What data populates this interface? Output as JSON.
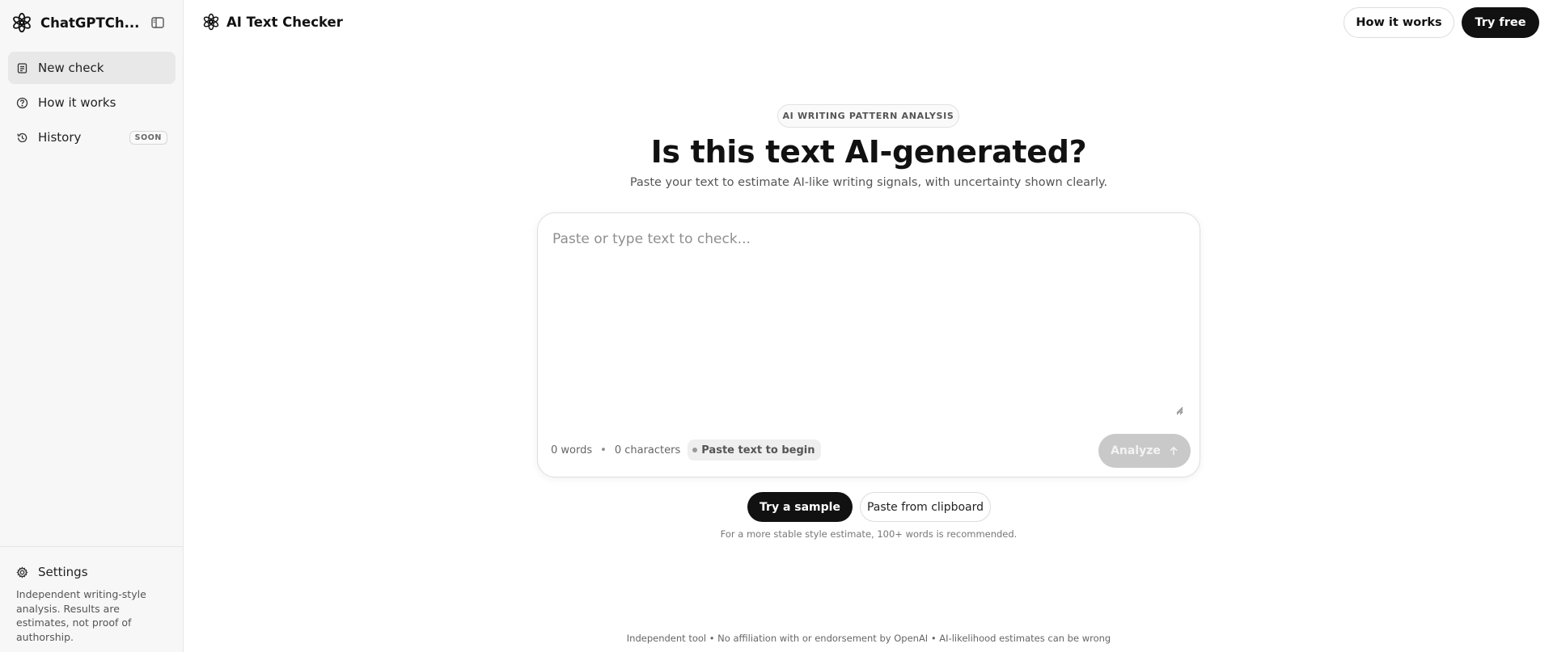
{
  "sidebar": {
    "brand": {
      "name": "ChatGPTCh...",
      "logo_icon": "openai-knot-icon",
      "toggle_icon": "sidebar-toggle-icon"
    },
    "items": [
      {
        "label": "New check",
        "icon": "document-icon",
        "active": true
      },
      {
        "label": "How it works",
        "icon": "question-circle-icon",
        "active": false
      },
      {
        "label": "History",
        "icon": "history-icon",
        "active": false,
        "badge": "SOON"
      }
    ],
    "settings": {
      "label": "Settings",
      "icon": "gear-icon"
    },
    "note": "Independent writing-style analysis. Results are estimates, not proof of authorship."
  },
  "header": {
    "title": "AI Text Checker",
    "how_label": "How it works",
    "try_label": "Try free"
  },
  "hero": {
    "eyebrow": "AI WRITING PATTERN ANALYSIS",
    "headline": "Is this text AI-generated?",
    "subline": "Paste your text to estimate AI-like writing signals, with uncertainty shown clearly."
  },
  "editor": {
    "placeholder": "Paste or type text to check...",
    "value": "",
    "words": "0 words",
    "separator": "•",
    "characters": "0 characters",
    "status": "Paste text to begin",
    "analyze_label": "Analyze"
  },
  "actions": {
    "sample_label": "Try a sample",
    "clipboard_label": "Paste from clipboard",
    "hint": "For a more stable style estimate, 100+ words is recommended."
  },
  "footer": {
    "note": "Independent tool • No affiliation with or endorsement by OpenAI • AI-likelihood estimates can be wrong"
  },
  "colors": {
    "accent": "#111111",
    "disabled": "#c9c9c9",
    "sidebar_bg": "#f7f7f7"
  }
}
